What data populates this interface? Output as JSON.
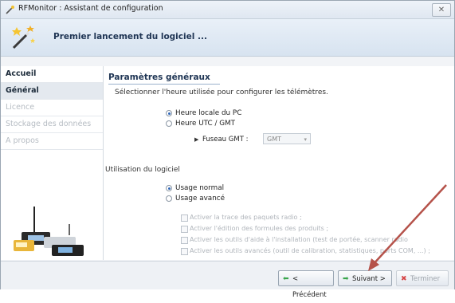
{
  "window": {
    "title": "RFMonitor : Assistant de configuration"
  },
  "banner": {
    "title": "Premier lancement du logiciel ..."
  },
  "sidebar": {
    "items": [
      {
        "label": "Accueil",
        "state": "done"
      },
      {
        "label": "Général",
        "state": "current"
      },
      {
        "label": "Licence",
        "state": "disabled"
      },
      {
        "label": "Stockage des données",
        "state": "disabled"
      },
      {
        "label": "A propos",
        "state": "disabled"
      }
    ]
  },
  "general": {
    "title": "Paramètres généraux",
    "description": "Sélectionner l'heure utilisée pour configurer les télémètres.",
    "time_options": [
      {
        "label": "Heure locale du PC",
        "selected": true
      },
      {
        "label": "Heure UTC / GMT",
        "selected": false
      }
    ],
    "timezone": {
      "label": "Fuseau GMT :",
      "value": "GMT"
    },
    "usage_title": "Utilisation du logiciel",
    "usage_options": [
      {
        "label": "Usage normal",
        "selected": true
      },
      {
        "label": "Usage avancé",
        "selected": false
      }
    ],
    "advanced_checks": [
      "Activer la trace des paquets radio ;",
      "Activer l'édition des formules des produits ;",
      "Activer les outils d'aide à l'installation (test de portée, scanner radio",
      "Activer les outils avancés (outil de calibration, statistiques, ports COM, ...) ;"
    ]
  },
  "footer": {
    "prev_label": "< Précédent",
    "next_label": "Suivant >",
    "finish_label": "Terminer"
  },
  "colors": {
    "accent": "#2e65b8",
    "annotation_arrow": "#b5524a"
  },
  "icons": {
    "title": "wand-icon",
    "banner": "wand-stars-icon",
    "prev": "arrow-left-icon",
    "next": "arrow-right-icon",
    "finish": "cancel-x-icon"
  }
}
